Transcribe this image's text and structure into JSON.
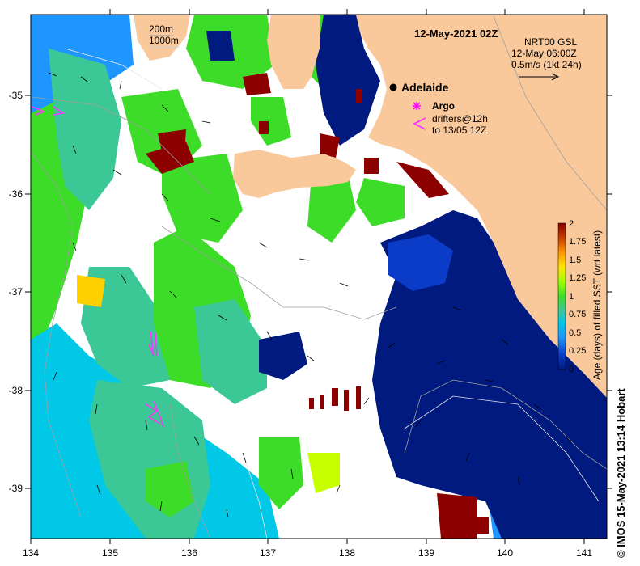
{
  "title": "12-May-2021 02Z",
  "current_product": {
    "name": "NRT00 GSL",
    "time": "12-May 06:00Z",
    "scale_label": "0.5m/s (1kt 24h)"
  },
  "isobath_legend": [
    "200m",
    "1000m"
  ],
  "place_label": "Adelaide",
  "legend": {
    "argo": "Argo",
    "drifters_line1": "drifters@12h",
    "drifters_line2": "to 13/05 12Z"
  },
  "colorbar": {
    "label": "Age (days) of filled SST (wrt latest)",
    "ticks": [
      "2",
      "1.75",
      "1.5",
      "1.25",
      "1",
      "0.75",
      "0.5",
      "0.25",
      "0"
    ],
    "colors": [
      "#001a80",
      "#0a3cc8",
      "#1e96ff",
      "#00c8e6",
      "#3cc896",
      "#3cdc28",
      "#a0ff00",
      "#ffe600",
      "#ff9600",
      "#c83c00",
      "#8c0000"
    ]
  },
  "axes": {
    "x_ticks": [
      "134",
      "135",
      "136",
      "137",
      "138",
      "139",
      "140",
      "141"
    ],
    "y_ticks": [
      "-35",
      "-36",
      "-37",
      "-38",
      "-39"
    ]
  },
  "palette": {
    "land": "#f9c89b",
    "no_data": "#ffffff",
    "argo": "#ff00ff",
    "drifter": "#ff33ff"
  },
  "credit": "© IMOS 15-May-2021 13:14 Hobart"
}
